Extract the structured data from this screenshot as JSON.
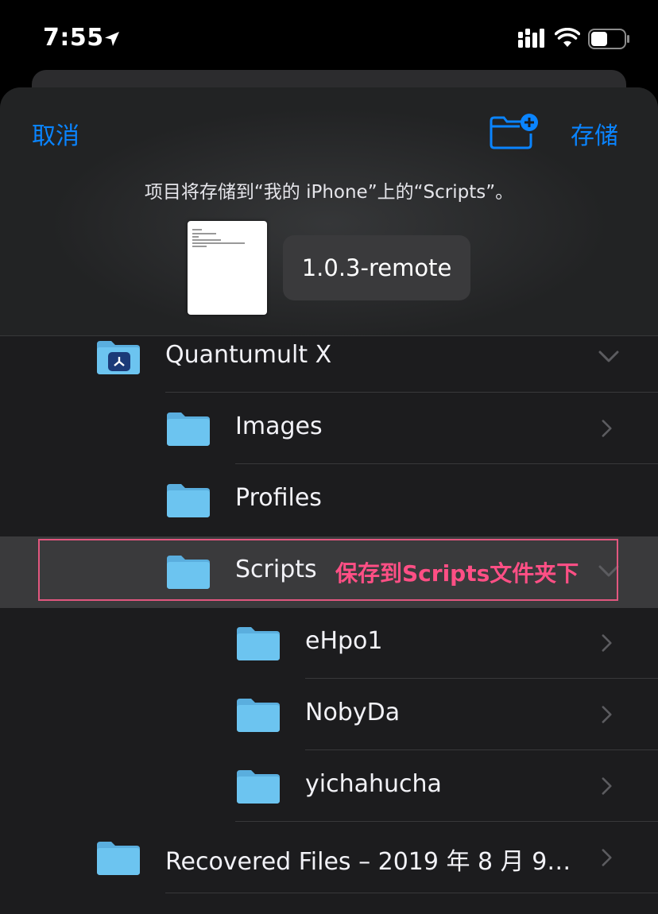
{
  "status_bar": {
    "time": "7:55"
  },
  "header": {
    "cancel_label": "取消",
    "save_label": "存储",
    "info": "项目将存储到“我的 iPhone”上的“Scripts”。"
  },
  "document": {
    "filename": "1.0.3-remote"
  },
  "folders": [
    {
      "name": "Quantumult X",
      "chevron": "down"
    },
    {
      "name": "Images",
      "chevron": "right"
    },
    {
      "name": "Profiles",
      "chevron": "none"
    },
    {
      "name": "Scripts",
      "chevron": "down",
      "selected": true
    },
    {
      "name": "eHpo1",
      "chevron": "right"
    },
    {
      "name": "NobyDa",
      "chevron": "right"
    },
    {
      "name": "yichahucha",
      "chevron": "right"
    },
    {
      "name": "Recovered Files – 2019 年 8 月 9…",
      "chevron": "right"
    }
  ],
  "annotation": {
    "text": "保存到Scripts文件夹下"
  },
  "colors": {
    "accent": "#0a84ff",
    "folder": "#6cc4f0",
    "annotation": "#ff4f85"
  }
}
